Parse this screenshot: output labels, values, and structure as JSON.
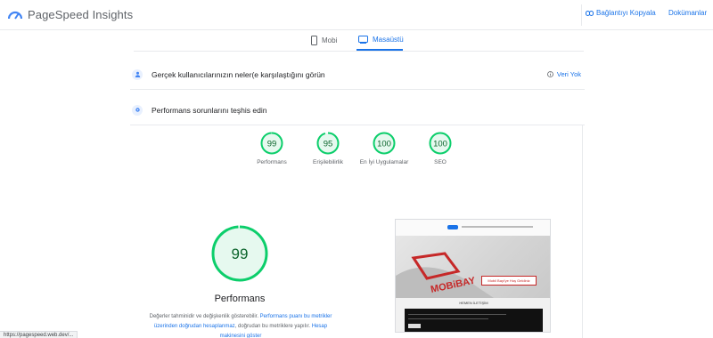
{
  "header": {
    "brand": "PageSpeed Insights",
    "copy_link_label": "Bağlantıyı Kopyala",
    "docs_label": "Dokümanlar"
  },
  "tabs": [
    {
      "label": "Mobi",
      "icon": "phone-icon",
      "active": false
    },
    {
      "label": "Masaüstü",
      "icon": "desktop-icon",
      "active": true
    }
  ],
  "sections": {
    "field": {
      "title": "Gerçek kullanıcılarınızın neler(e karşılaştığını görün",
      "no_data": "Veri Yok"
    },
    "lab": {
      "title": "Performans sorunlarını teşhis edin"
    }
  },
  "scores": [
    {
      "label": "Performans",
      "value": "99",
      "score": 99
    },
    {
      "label": "Erişilebilirlik",
      "value": "95",
      "score": 95
    },
    {
      "label": "En İyi Uygulamalar",
      "value": "100",
      "score": 100
    },
    {
      "label": "SEO",
      "value": "100",
      "score": 100
    }
  ],
  "main_score": {
    "value": "99",
    "score": 99,
    "label": "Performans"
  },
  "description": {
    "part1": "Değerler tahminidir ve değişkenlik gösterebilir. ",
    "link1": "Performans puanı bu metrikler üzerinden doğrudan",
    "link1b": "hesaplanmaz",
    "part2": ", doğrudan bu metriklere yapılır.",
    "link2": "Hesap makinesini göster"
  },
  "thumbnail": {
    "hero_text": "Mobil Bayi'ye Hoş Geldiniz",
    "dark_title": "HEMEN İLETİŞİM"
  },
  "status_url": "https://pagespeed.web.dev/...",
  "colors": {
    "pass": "#0cce6b",
    "pass_bg": "#e6f9ef",
    "pass_text": "#0d652d",
    "accent": "#1a73e8"
  }
}
